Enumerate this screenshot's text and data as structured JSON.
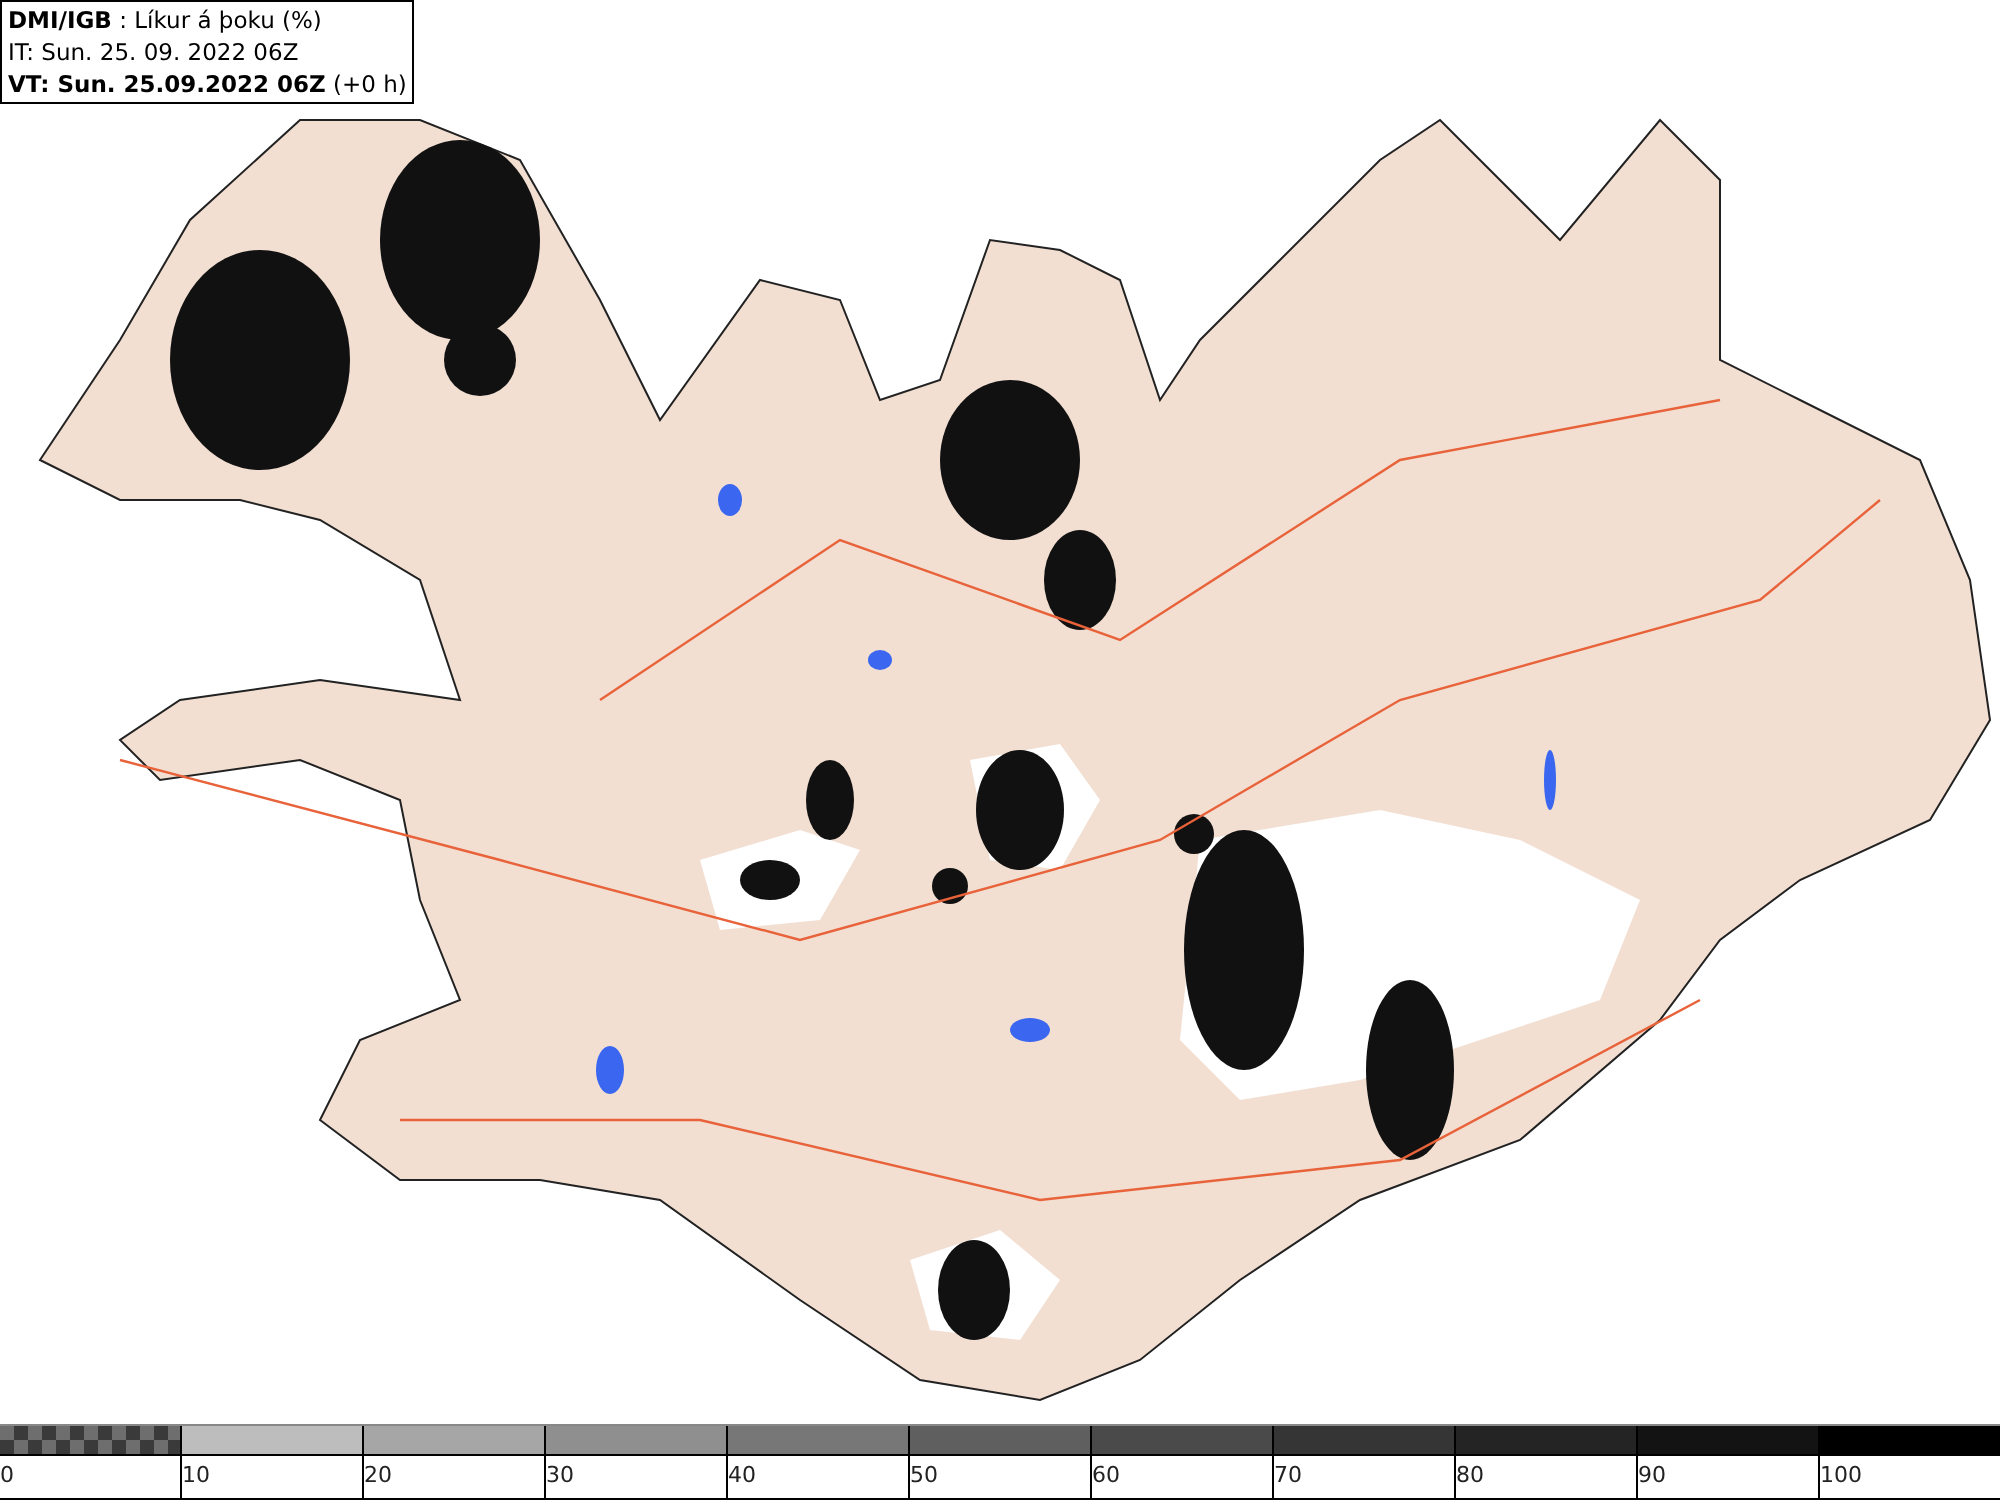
{
  "header": {
    "lines": [
      "**DMI/IGB** : Líkur á þoku (%)",
      "IT: Sun. 25. 09. 2022 06Z",
      "**VT: Sun. 25.09.2022 06Z** (+0 h)"
    ]
  },
  "legend": [
    {
      "kind": "checker",
      "color": "#6e6e6e",
      "label": "0"
    },
    {
      "kind": "solid",
      "color": "#bdbdbd",
      "label": "10"
    },
    {
      "kind": "solid",
      "color": "#a6a6a6",
      "label": "20"
    },
    {
      "kind": "solid",
      "color": "#8f8f8f",
      "label": "30"
    },
    {
      "kind": "solid",
      "color": "#777777",
      "label": "40"
    },
    {
      "kind": "solid",
      "color": "#5f5f5f",
      "label": "50"
    },
    {
      "kind": "solid",
      "color": "#4a4a4a",
      "label": "60"
    },
    {
      "kind": "solid",
      "color": "#353535",
      "label": "70"
    },
    {
      "kind": "solid",
      "color": "#242424",
      "label": "80"
    },
    {
      "kind": "solid",
      "color": "#131313",
      "label": "90"
    },
    {
      "kind": "solid",
      "color": "#000000",
      "label": "100"
    }
  ]
}
